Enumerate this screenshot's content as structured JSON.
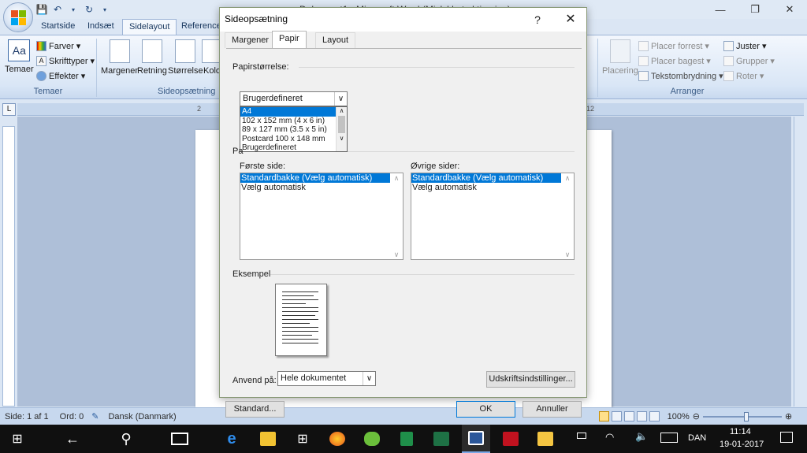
{
  "window": {
    "title": "Dokument1 - Microsoft Word (Mislykket aktivering)",
    "min": "—",
    "restore": "❐",
    "close": "✕"
  },
  "qat": {
    "save_icon": "save-icon",
    "undo_icon": "undo-icon",
    "redo_icon": "redo-icon"
  },
  "ribbon": {
    "tabs": [
      "Startside",
      "Indsæt",
      "Sidelayout",
      "Referencer"
    ],
    "active_tab": "Sidelayout",
    "groups": {
      "temaer": {
        "label": "Temaer",
        "temaer_button": "Temaer",
        "farver": "Farver",
        "skrifttyper": "Skrifttyper",
        "effekter": "Effekter"
      },
      "sideopsaetning": {
        "label": "Sideopsætning",
        "margener": "Margener",
        "retning": "Retning",
        "stoerrelse": "Størrelse",
        "kolonner": "Kolo"
      },
      "arranger": {
        "label": "Arranger",
        "placering": "Placering",
        "placer_forrest": "Placer forrest",
        "placer_bagest": "Placer bagest",
        "tekstombrydning": "Tekstombrydning",
        "juster": "Juster",
        "grupper": "Grupper",
        "roter": "Roter"
      }
    }
  },
  "ruler": {
    "tab_button": "L",
    "left_number": "2",
    "right_number": "12"
  },
  "dialog": {
    "title": "Sideopsætning",
    "help": "?",
    "close": "✕",
    "tabs": [
      "Margener",
      "Papir",
      "Layout"
    ],
    "active_tab": "Papir",
    "papirstoerrelse": {
      "label": "Papirstørrelse:",
      "selected": "Brugerdefineret",
      "options": [
        "A4",
        "102 x 152 mm (4 x 6 in)",
        "89 x 127 mm (3.5 x 5 in)",
        "Postcard 100 x 148 mm",
        "Brugerdefineret"
      ],
      "highlighted": "A4"
    },
    "papirkilde": {
      "label": "Pa",
      "foerste_side_label": "Første side:",
      "oevrige_sider_label": "Øvrige sider:",
      "foerste_side_items": [
        "Standardbakke (Vælg automatisk)",
        "Vælg automatisk"
      ],
      "oevrige_sider_items": [
        "Standardbakke (Vælg automatisk)",
        "Vælg automatisk"
      ]
    },
    "eksempel": {
      "label": "Eksempel"
    },
    "anvend_paa": {
      "label": "Anvend på:",
      "value": "Hele dokumentet"
    },
    "buttons": {
      "udskriftsindstillinger": "Udskriftsindstillinger...",
      "standard": "Standard...",
      "ok": "OK",
      "annuller": "Annuller"
    }
  },
  "statusbar": {
    "side": "Side: 1 af 1",
    "ord": "Ord: 0",
    "sprog": "Dansk (Danmark)",
    "zoom": "100%"
  },
  "taskbar": {
    "language": "DAN",
    "time": "11:14",
    "date": "19-01-2017"
  }
}
